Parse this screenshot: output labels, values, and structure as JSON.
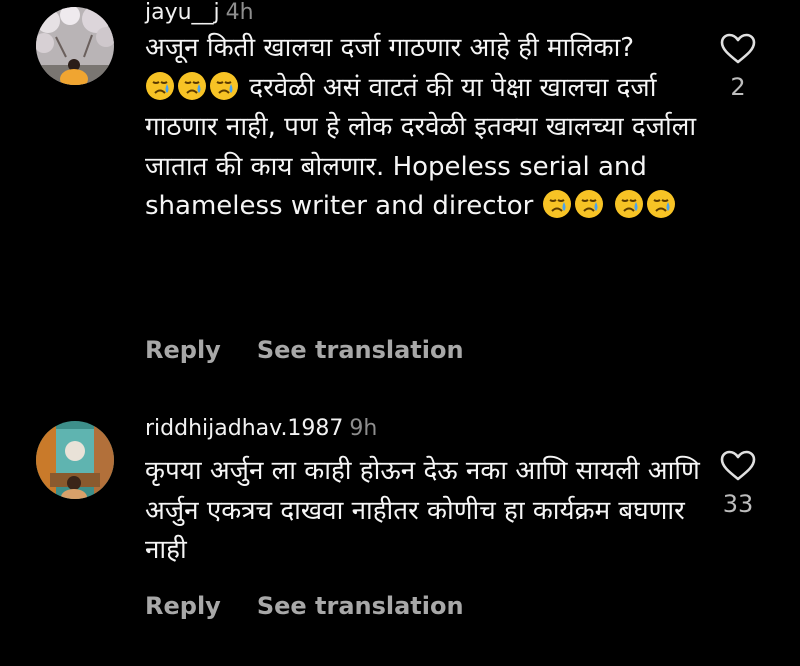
{
  "comments": [
    {
      "username": "jayu__j",
      "time": "4h",
      "text_before_emojis": "अजून किती खालचा दर्जा गाठणार आहे ही मालिका?",
      "text_after_emojis": "दरवेळी असं वाटतं की या पेक्षा खालचा दर्जा गाठणार नाही, पण हे लोक दरवेळी इतक्या खालच्या दर्जाला जातात की काय बोलणार. Hopeless serial and shameless writer and director",
      "emoji_name": "crying-face-emoji",
      "like_count": "2",
      "reply_label": "Reply",
      "translate_label": "See translation"
    },
    {
      "username": "riddhijadhav.1987",
      "time": "9h",
      "text": "कृपया अर्जुन ला काही होऊन देऊ नका आणि सायली आणि अर्जुन एकत्रच दाखवा नाहीतर कोणीच हा कार्यक्रम बघणार नाही",
      "like_count": "33",
      "reply_label": "Reply",
      "translate_label": "See translation"
    }
  ],
  "colors": {
    "background": "#000000",
    "username": "#f2f2f2",
    "muted": "#8e8e8e",
    "action": "#a8a8a8",
    "body_text": "#f5f5f5"
  }
}
